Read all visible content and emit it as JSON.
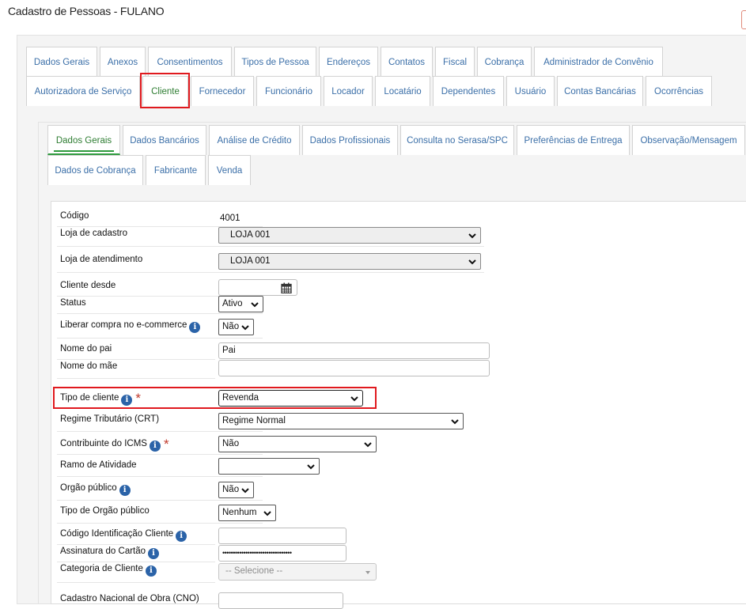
{
  "page": {
    "title": "Cadastro de Pessoas - FULANO"
  },
  "main_tabs_row1": [
    "Dados Gerais",
    "Anexos",
    "Consentimentos",
    "Tipos de Pessoa",
    "Endereços",
    "Contatos",
    "Fiscal",
    "Cobrança",
    "Administrador de Convênio"
  ],
  "main_tabs_row2": [
    "Autorizadora de Serviço",
    "Cliente",
    "Fornecedor",
    "Funcionário",
    "Locador",
    "Locatário",
    "Dependentes",
    "Usuário",
    "Contas Bancárias",
    "Ocorrências"
  ],
  "sub_tabs_row1": [
    "Dados Gerais",
    "Dados Bancários",
    "Análise de Crédito",
    "Dados Profissionais",
    "Consulta no Serasa/SPC",
    "Preferências de Entrega",
    "Observação/Mensagem"
  ],
  "sub_tabs_row2": [
    "Dados de Cobrança",
    "Fabricante",
    "Venda"
  ],
  "form": {
    "codigo": {
      "label": "Código",
      "value": "4001"
    },
    "loja_cadastro": {
      "label": "Loja de cadastro",
      "value": "LOJA 001"
    },
    "loja_atendimento": {
      "label": "Loja de atendimento",
      "value": "LOJA 001"
    },
    "cliente_desde": {
      "label": "Cliente desde",
      "value": ""
    },
    "status": {
      "label": "Status",
      "value": "Ativo"
    },
    "liberar_ecommerce": {
      "label": "Liberar compra no e-commerce",
      "value": "Não"
    },
    "nome_pai": {
      "label": "Nome do pai",
      "value": "Pai"
    },
    "nome_mae": {
      "label": "Nome do mãe",
      "value": ""
    },
    "tipo_cliente": {
      "label": "Tipo de cliente",
      "value": "Revenda",
      "required_mark": "*"
    },
    "regime_tributario": {
      "label": "Regime Tributário (CRT)",
      "value": "Regime Normal"
    },
    "contribuinte_icms": {
      "label": "Contribuinte do ICMS",
      "value": "Não",
      "required_mark": "*"
    },
    "ramo_atividade": {
      "label": "Ramo de Atividade",
      "value": ""
    },
    "orgao_publico": {
      "label": "Orgão público",
      "value": "Não"
    },
    "tipo_orgao_publico": {
      "label": "Tipo de Orgão público",
      "value": "Nenhum"
    },
    "codigo_identificacao": {
      "label": "Código Identificação Cliente",
      "value": ""
    },
    "assinatura_cartao": {
      "label": "Assinatura do Cartão",
      "value": "•••••••••••••••••••••••••••••••••"
    },
    "categoria_cliente": {
      "label": "Categoria de Cliente",
      "placeholder": "-- Selecione --"
    },
    "cno": {
      "label": "Cadastro Nacional de Obra (CNO)"
    }
  },
  "icons": {
    "info": "info-icon",
    "calendar": "calendar-icon",
    "dropdown": "chevron-down-icon"
  },
  "colors": {
    "tab_link": "#3b6fa8",
    "active_tab": "#2e7d32",
    "highlight": "#e0191e",
    "required": "#c0392b"
  }
}
